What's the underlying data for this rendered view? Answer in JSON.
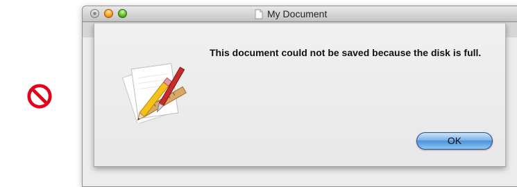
{
  "window": {
    "title": "My Document"
  },
  "alert": {
    "message": "This document could not be saved because the disk is full.",
    "ok_label": "OK"
  },
  "icons": {
    "marker": "no-entry-icon",
    "document": "document-proxy-icon",
    "app": "textedit-app-icon"
  },
  "colors": {
    "no_symbol": "#e3001b",
    "default_button": "#4c90d8",
    "minimize": "#f2a21e",
    "zoom": "#5fbd2c"
  }
}
